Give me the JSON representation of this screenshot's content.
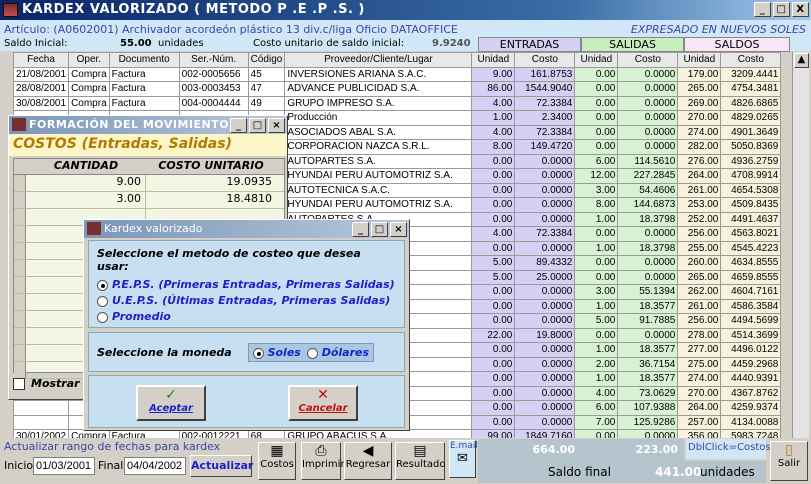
{
  "window": {
    "title": "KARDEX VALORIZADO ( METODO P .E .P .S. )",
    "min": "_",
    "max": "□",
    "close": "X"
  },
  "info": {
    "articulo": "Artículo: (A0602001) Archivador acordeón plástico 13 div.c/liga Oficio DATAOFFICE",
    "expresado": "EXPRESADO EN NUEVOS SOLES",
    "saldo_inicial_label": "Saldo Inicial:",
    "saldo_inicial_val": "55.00",
    "unidades": "unidades",
    "costo_unit_label": "Costo unitario de saldo inicial:",
    "costo_unit_val": "9.9240"
  },
  "groups": {
    "entradas": "ENTRADAS",
    "salidas": "SALIDAS",
    "saldos": "SALDOS"
  },
  "columns": [
    "Fecha",
    "Oper.",
    "Documento",
    "Ser.-Núm.",
    "Código",
    "Proveedor/Cliente/Lugar",
    "Unidad",
    "Costo",
    "Unidad",
    "Costo",
    "Unidad",
    "Costo"
  ],
  "rows": [
    [
      "21/08/2001",
      "Compra",
      "Factura",
      "002-0005656",
      "45",
      "INVERSIONES ARIANA S.A.C.",
      "9.00",
      "161.8753",
      "0.00",
      "0.0000",
      "179.00",
      "3209.4441"
    ],
    [
      "28/08/2001",
      "Compra",
      "Factura",
      "003-0003453",
      "47",
      "ADVANCE PUBLICIDAD S.A.",
      "86.00",
      "1544.9040",
      "0.00",
      "0.0000",
      "265.00",
      "4754.3481"
    ],
    [
      "30/08/2001",
      "Compra",
      "Factura",
      "004-0004444",
      "49",
      "GRUPO IMPRESO S.A.",
      "4.00",
      "72.3384",
      "0.00",
      "0.0000",
      "269.00",
      "4826.6865"
    ],
    [
      "",
      "",
      "",
      "",
      "",
      "Producción",
      "1.00",
      "2.3400",
      "0.00",
      "0.0000",
      "270.00",
      "4829.0265"
    ],
    [
      "",
      "",
      "",
      "",
      "",
      "ASOCIADOS ABAL S.A.",
      "4.00",
      "72.3384",
      "0.00",
      "0.0000",
      "274.00",
      "4901.3649"
    ],
    [
      "",
      "",
      "",
      "",
      "",
      "CORPORACION NAZCA S.R.L.",
      "8.00",
      "149.4720",
      "0.00",
      "0.0000",
      "282.00",
      "5050.8369"
    ],
    [
      "",
      "",
      "",
      "",
      "",
      "AUTOPARTES S.A.",
      "0.00",
      "0.0000",
      "6.00",
      "114.5610",
      "276.00",
      "4936.2759"
    ],
    [
      "",
      "",
      "",
      "",
      "",
      "HYUNDAI PERU AUTOMOTRIZ S.A.",
      "0.00",
      "0.0000",
      "12.00",
      "227.2845",
      "264.00",
      "4708.9914"
    ],
    [
      "",
      "",
      "",
      "",
      "",
      "AUTOTECNICA S.A.C.",
      "0.00",
      "0.0000",
      "3.00",
      "54.4606",
      "261.00",
      "4654.5308"
    ],
    [
      "",
      "",
      "",
      "",
      "",
      "HYUNDAI PERU AUTOMOTRIZ S.A.",
      "0.00",
      "0.0000",
      "8.00",
      "144.6873",
      "253.00",
      "4509.8435"
    ],
    [
      "",
      "",
      "",
      "",
      "",
      "AUTOPARTES S.A.",
      "0.00",
      "0.0000",
      "1.00",
      "18.3798",
      "252.00",
      "4491.4637"
    ],
    [
      "",
      "",
      "",
      "",
      "",
      "",
      "4.00",
      "72.3384",
      "0.00",
      "0.0000",
      "256.00",
      "4563.8021"
    ],
    [
      "",
      "",
      "",
      "",
      "",
      "OMOTRIZ S.A.",
      "0.00",
      "0.0000",
      "1.00",
      "18.3798",
      "255.00",
      "4545.4223"
    ],
    [
      "",
      "",
      "",
      "",
      "",
      "O S.A.",
      "5.00",
      "89.4332",
      "0.00",
      "0.0000",
      "260.00",
      "4634.8555"
    ],
    [
      "",
      "",
      "",
      "",
      "",
      "",
      "5.00",
      "25.0000",
      "0.00",
      "0.0000",
      "265.00",
      "4659.8555"
    ],
    [
      "",
      "",
      "",
      "",
      "",
      "A.",
      "0.00",
      "0.0000",
      "3.00",
      "55.1394",
      "262.00",
      "4604.7161"
    ],
    [
      "",
      "",
      "",
      "",
      "",
      "",
      "0.00",
      "0.0000",
      "1.00",
      "18.3577",
      "261.00",
      "4586.3584"
    ],
    [
      "",
      "",
      "",
      "",
      "",
      "A.",
      "0.00",
      "0.0000",
      "5.00",
      "91.7885",
      "256.00",
      "4494.5699"
    ],
    [
      "",
      "",
      "",
      "",
      "",
      "",
      "22.00",
      "19.8000",
      "0.00",
      "0.0000",
      "278.00",
      "4514.3699"
    ],
    [
      "",
      "",
      "",
      "",
      "",
      "",
      "0.00",
      "0.0000",
      "1.00",
      "18.3577",
      "277.00",
      "4496.0122"
    ],
    [
      "",
      "",
      "",
      "",
      "",
      "E S.R.L.",
      "0.00",
      "0.0000",
      "2.00",
      "36.7154",
      "275.00",
      "4459.2968"
    ],
    [
      "",
      "",
      "",
      "",
      "",
      "OMOTRIZ S.A.C.",
      "0.00",
      "0.0000",
      "1.00",
      "18.3577",
      "274.00",
      "4440.9391"
    ],
    [
      "",
      "",
      "",
      "",
      "",
      "",
      "0.00",
      "0.0000",
      "4.00",
      "73.0629",
      "270.00",
      "4367.8762"
    ],
    [
      "",
      "",
      "",
      "",
      "",
      "A.",
      "0.00",
      "0.0000",
      "6.00",
      "107.9388",
      "264.00",
      "4259.9374"
    ],
    [
      "",
      "",
      "",
      "",
      "",
      "OMOTRIZ S.A.C.",
      "0.00",
      "0.0000",
      "7.00",
      "125.9286",
      "257.00",
      "4134.0088"
    ],
    [
      "30/01/2002",
      "Compra",
      "Factura",
      "002-0012221",
      "68",
      "GRUPO ABACUS S.A.",
      "99.00",
      "1849.7160",
      "0.00",
      "0.0000",
      "356.00",
      "5983.7248"
    ]
  ],
  "bottom": {
    "rango_label": "Actualizar rango de fechas para kardex",
    "inicio_label": "Inicio",
    "inicio_val": "01/03/2001",
    "final_label": "Final",
    "final_val": "04/04/2002",
    "actualizar": "Actualizar",
    "costos": "Costos",
    "imprimir": "Imprimir",
    "regresar": "Regresar",
    "resultado": "Resultado",
    "email": "E.mail",
    "total_ent": "664.00",
    "total_sal": "223.00",
    "dblclick": "DblClick=Costos",
    "saldo_final_label": "Saldo final",
    "saldo_final_val": "441.00",
    "saldo_unidades": "unidades",
    "salir": "Salir"
  },
  "formacion": {
    "title": "FORMACIÓN DEL MOVIMIENTO",
    "heading": "COSTOS (Entradas, Salidas)",
    "col_cantidad": "CANTIDAD",
    "col_costo": "COSTO UNITARIO",
    "rows": [
      [
        "9.00",
        "19.0935"
      ],
      [
        "3.00",
        "18.4810"
      ]
    ],
    "mostrar": "Mostrar"
  },
  "dialog": {
    "title": "Kardex valorizado",
    "prompt": "Seleccione el metodo de costeo que desea usar:",
    "opt1": "P.E.P.S. (Primeras Entradas, Primeras Salidas)",
    "opt2": "U.E.P.S. (Últimas Entradas, Primeras Salidas)",
    "opt3": "Promedio",
    "moneda_label": "Seleccione la moneda",
    "soles": "Soles",
    "dolares": "Dólares",
    "aceptar": "Aceptar",
    "cancelar": "Cancelar"
  }
}
